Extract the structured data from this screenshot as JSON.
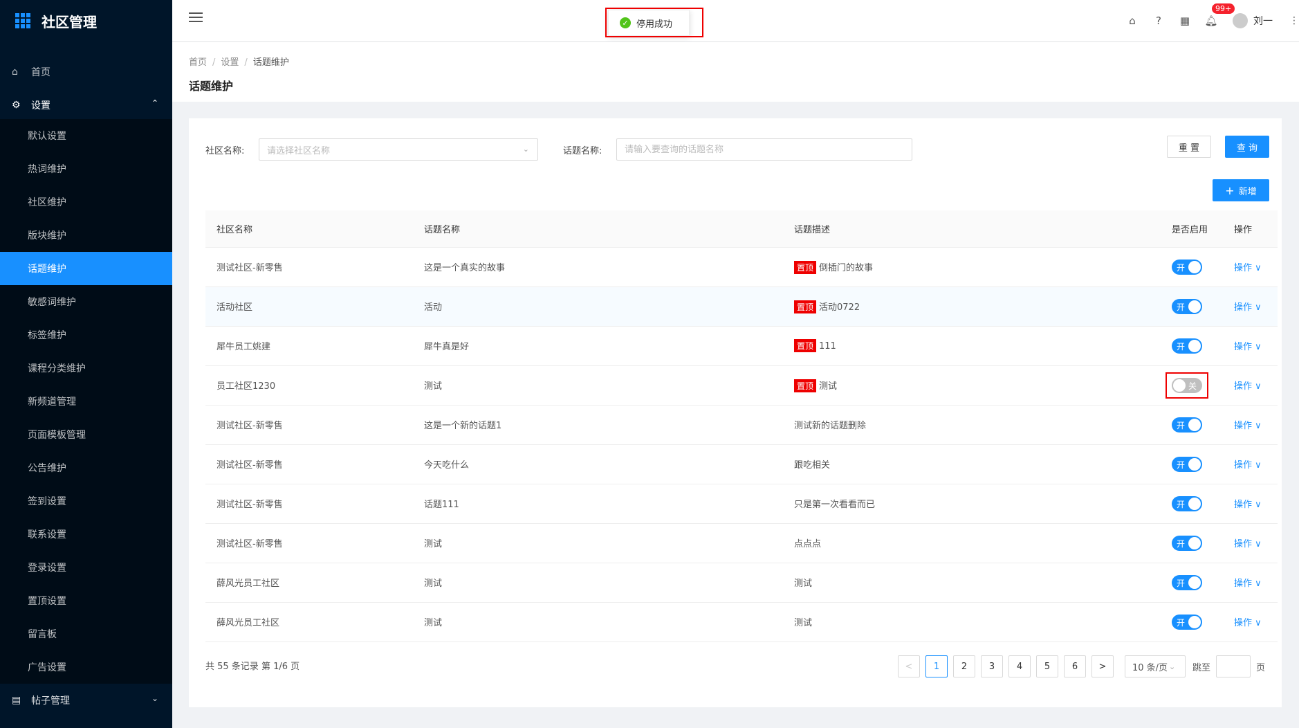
{
  "sidebar": {
    "title": "社区管理",
    "home": "首页",
    "group": "设置",
    "items": [
      {
        "label": "默认设置"
      },
      {
        "label": "热词维护"
      },
      {
        "label": "社区维护"
      },
      {
        "label": "版块维护"
      },
      {
        "label": "话题维护"
      },
      {
        "label": "敏感词维护"
      },
      {
        "label": "标签维护"
      },
      {
        "label": "课程分类维护"
      },
      {
        "label": "新频道管理"
      },
      {
        "label": "页面模板管理"
      },
      {
        "label": "公告维护"
      },
      {
        "label": "签到设置"
      },
      {
        "label": "联系设置"
      },
      {
        "label": "登录设置"
      },
      {
        "label": "置顶设置"
      },
      {
        "label": "留言板"
      },
      {
        "label": "广告设置"
      }
    ],
    "bottom": "帖子管理"
  },
  "header": {
    "toast": "停用成功",
    "badge": "99+",
    "username": "刘一"
  },
  "breadcrumb": {
    "a": "首页",
    "b": "设置",
    "c": "话题维护"
  },
  "page_title": "话题维护",
  "filters": {
    "community_label": "社区名称:",
    "community_placeholder": "请选择社区名称",
    "topic_label": "话题名称:",
    "topic_placeholder": "请输入要查询的话题名称",
    "reset": "重 置",
    "search": "查 询",
    "add": "新增"
  },
  "table": {
    "headers": [
      "社区名称",
      "话题名称",
      "话题描述",
      "是否启用",
      "操作"
    ],
    "pin_label": "置顶",
    "on_label": "开",
    "off_label": "关",
    "op_label": "操作 ∨",
    "rows": [
      {
        "community": "测试社区-新零售",
        "topic": "这是一个真实的故事",
        "pinned": true,
        "desc": "倒插门的故事",
        "enabled": true
      },
      {
        "community": "活动社区",
        "topic": "活动",
        "pinned": true,
        "desc": "活动0722",
        "enabled": true
      },
      {
        "community": "犀牛员工姚建",
        "topic": "犀牛真是好",
        "pinned": true,
        "desc": "111",
        "enabled": true
      },
      {
        "community": "员工社区1230",
        "topic": "测试",
        "pinned": true,
        "desc": "测试",
        "enabled": false
      },
      {
        "community": "测试社区-新零售",
        "topic": "这是一个新的话题1",
        "pinned": false,
        "desc": "测试新的话题删除",
        "enabled": true
      },
      {
        "community": "测试社区-新零售",
        "topic": "今天吃什么",
        "pinned": false,
        "desc": "跟吃相关",
        "enabled": true
      },
      {
        "community": "测试社区-新零售",
        "topic": "话题111",
        "pinned": false,
        "desc": "只是第一次看看而已",
        "enabled": true
      },
      {
        "community": "测试社区-新零售",
        "topic": "测试",
        "pinned": false,
        "desc": "点点点",
        "enabled": true
      },
      {
        "community": "薛风光员工社区",
        "topic": "测试",
        "pinned": false,
        "desc": "测试",
        "enabled": true
      },
      {
        "community": "薛风光员工社区",
        "topic": "测试",
        "pinned": false,
        "desc": "测试",
        "enabled": true
      }
    ]
  },
  "pagination": {
    "total": "共 55 条记录 第 1/6 页",
    "pages": [
      "1",
      "2",
      "3",
      "4",
      "5",
      "6"
    ],
    "current": "1",
    "prev": "<",
    "next": ">",
    "page_size": "10 条/页",
    "jump_label": "跳至",
    "jump_unit": "页"
  }
}
